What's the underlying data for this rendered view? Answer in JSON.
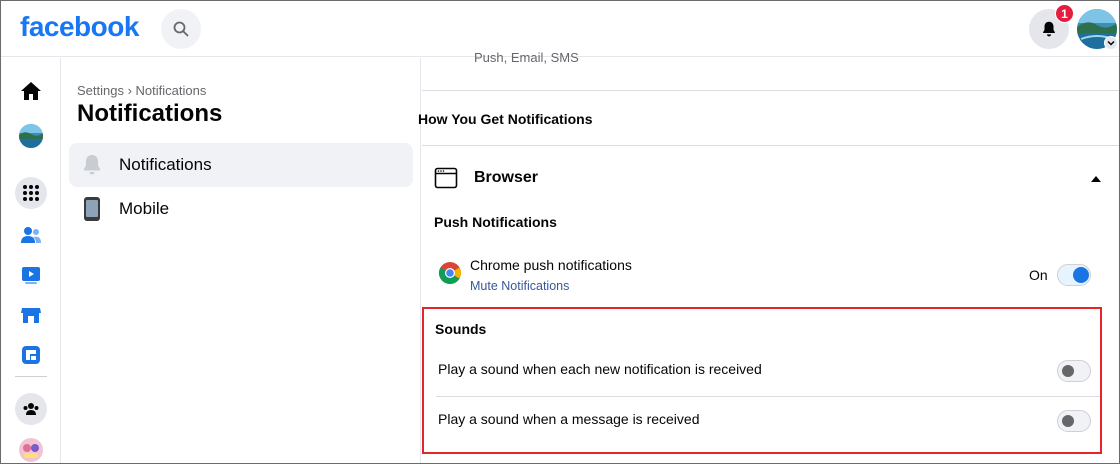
{
  "topbar": {
    "logo": "facebook",
    "notification_count": "1"
  },
  "sidebar": {
    "breadcrumb": "Settings › Notifications",
    "title": "Notifications",
    "items": [
      {
        "label": "Notifications",
        "icon": "bell-icon",
        "active": true
      },
      {
        "label": "Mobile",
        "icon": "mobile-phone-icon",
        "active": false
      }
    ]
  },
  "main": {
    "previous_item_text": "Push, Email, SMS",
    "section_title": "How You Get Notifications",
    "browser": {
      "label": "Browser",
      "push_title": "Push Notifications",
      "chrome_label": "Chrome push notifications",
      "mute_link": "Mute Notifications",
      "state_label": "On",
      "push_enabled": true
    },
    "sounds": {
      "title": "Sounds",
      "rows": [
        {
          "label": "Play a sound when each new notification is received",
          "enabled": false
        },
        {
          "label": "Play a sound when a message is received",
          "enabled": false
        }
      ]
    }
  },
  "colors": {
    "brand": "#1877f2",
    "highlight_box": "#e3262a",
    "badge": "#e41e3f",
    "link": "#385898"
  }
}
